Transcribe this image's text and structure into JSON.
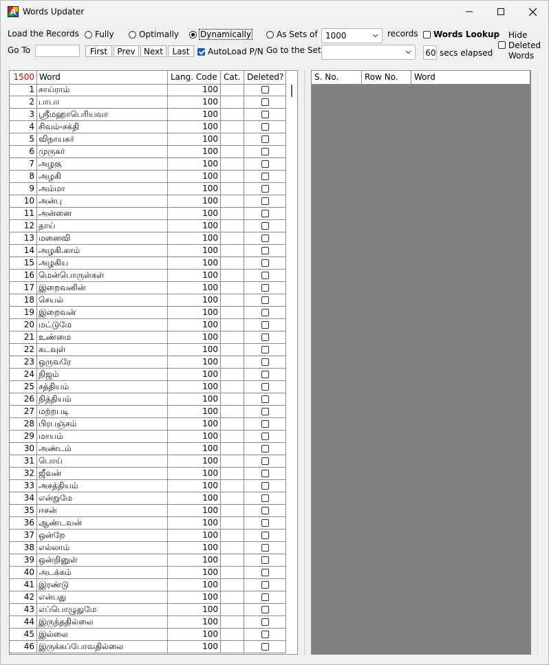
{
  "window": {
    "title": "Words Updater"
  },
  "toolbar": {
    "load_label": "Load the Records",
    "radio_fully": "Fully",
    "radio_optimally": "Optimally",
    "radio_dynamically": "Dynamically",
    "radio_assets": "As Sets of",
    "sets_value": "1000",
    "records_label": "records",
    "words_lookup_label": "Words Lookup",
    "hide_deleted_line1": "Hide",
    "hide_deleted_line2": "Deleted",
    "hide_deleted_line3": "Words",
    "goto_label": "Go To",
    "goto_value": "",
    "first_label": "First",
    "prev_label": "Prev",
    "next_label": "Next",
    "last_label": "Last",
    "autoload_label": "AutoLoad P/N",
    "goto_set_label": "Go to the Set",
    "goto_set_value": "",
    "secs_value": "60",
    "secs_label": "secs elapsed"
  },
  "grid": {
    "count": "1500",
    "columns": {
      "word": "Word",
      "lang": "Lang. Code",
      "cat": "Cat.",
      "deleted": "Deleted?"
    },
    "rows": [
      {
        "no": "1",
        "word": "சாய்ராம்",
        "lang": "100"
      },
      {
        "no": "2",
        "word": "பாபா",
        "lang": "100"
      },
      {
        "no": "3",
        "word": "ஸ்ரீமஹாபெரியவா",
        "lang": "100"
      },
      {
        "no": "4",
        "word": "சிவம்-சக்தி",
        "lang": "100"
      },
      {
        "no": "5",
        "word": "விநாயகர்",
        "lang": "100"
      },
      {
        "no": "6",
        "word": "முருகர்",
        "lang": "100"
      },
      {
        "no": "7",
        "word": "அழகு",
        "lang": "100"
      },
      {
        "no": "8",
        "word": "அழகி",
        "lang": "100"
      },
      {
        "no": "9",
        "word": "அம்மா",
        "lang": "100"
      },
      {
        "no": "10",
        "word": "அன்பு",
        "lang": "100"
      },
      {
        "no": "11",
        "word": "அன்னை",
        "lang": "100"
      },
      {
        "no": "12",
        "word": "தாய்",
        "lang": "100"
      },
      {
        "no": "13",
        "word": "மனைவி",
        "lang": "100"
      },
      {
        "no": "14",
        "word": "அழகி.காம்",
        "lang": "100"
      },
      {
        "no": "15",
        "word": "அழகிய",
        "lang": "100"
      },
      {
        "no": "16",
        "word": "மென்பொருள்கள்",
        "lang": "100"
      },
      {
        "no": "17",
        "word": "இறைவனின்",
        "lang": "100"
      },
      {
        "no": "18",
        "word": "செயல்",
        "lang": "100"
      },
      {
        "no": "19",
        "word": "இறைவன்",
        "lang": "100"
      },
      {
        "no": "20",
        "word": "மட்டுமே",
        "lang": "100"
      },
      {
        "no": "21",
        "word": "உண்மை",
        "lang": "100"
      },
      {
        "no": "22",
        "word": "கடவுள்",
        "lang": "100"
      },
      {
        "no": "23",
        "word": "ஒருவரே",
        "lang": "100"
      },
      {
        "no": "24",
        "word": "நிஜம்",
        "lang": "100"
      },
      {
        "no": "25",
        "word": "சத்தியம்",
        "lang": "100"
      },
      {
        "no": "26",
        "word": "நித்தியம்",
        "lang": "100"
      },
      {
        "no": "27",
        "word": "மற்றபடி",
        "lang": "100"
      },
      {
        "no": "28",
        "word": "பிரபஞ்சம்",
        "lang": "100"
      },
      {
        "no": "29",
        "word": "மாயம்",
        "lang": "100"
      },
      {
        "no": "30",
        "word": "அண்டம்",
        "lang": "100"
      },
      {
        "no": "31",
        "word": "பொய்",
        "lang": "100"
      },
      {
        "no": "32",
        "word": "ஜீவன்",
        "lang": "100"
      },
      {
        "no": "33",
        "word": "அசத்தியம்",
        "lang": "100"
      },
      {
        "no": "34",
        "word": "என்றுமே",
        "lang": "100"
      },
      {
        "no": "35",
        "word": "ஈசன்",
        "lang": "100"
      },
      {
        "no": "36",
        "word": "ஆண்டவன்",
        "lang": "100"
      },
      {
        "no": "37",
        "word": "ஒன்றே",
        "lang": "100"
      },
      {
        "no": "38",
        "word": "எல்லாம்",
        "lang": "100"
      },
      {
        "no": "39",
        "word": "ஒன்றினுள்",
        "lang": "100"
      },
      {
        "no": "40",
        "word": "அடக்கம்",
        "lang": "100"
      },
      {
        "no": "41",
        "word": "இரண்டு",
        "lang": "100"
      },
      {
        "no": "42",
        "word": "என்பது",
        "lang": "100"
      },
      {
        "no": "43",
        "word": "எப்பொழுதுமே",
        "lang": "100"
      },
      {
        "no": "44",
        "word": "இருந்ததில்லை",
        "lang": "100"
      },
      {
        "no": "45",
        "word": "இல்லை",
        "lang": "100"
      },
      {
        "no": "46",
        "word": "இருக்கப்போவதில்லை",
        "lang": "100"
      }
    ]
  },
  "lookup": {
    "columns": {
      "sno": "S. No.",
      "rowno": "Row No.",
      "word": "Word"
    }
  },
  "colors": {
    "count": "#d00000",
    "check_on": "#1a5fb4",
    "lookup_bg": "#808080"
  }
}
